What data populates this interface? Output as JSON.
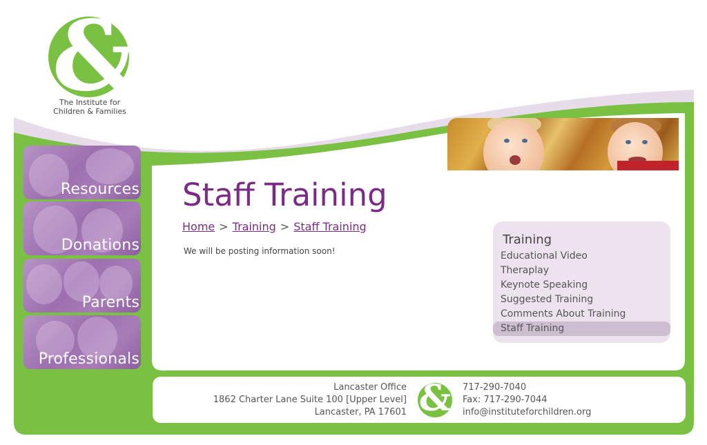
{
  "logo": {
    "line1": "The Institute for",
    "line2": "Children & Families"
  },
  "side_nav": {
    "items": [
      {
        "label": "Resources"
      },
      {
        "label": "Donations"
      },
      {
        "label": "Parents"
      },
      {
        "label": "Professionals"
      }
    ]
  },
  "main": {
    "title": "Staff Training",
    "breadcrumb": {
      "home": "Home",
      "sep1": ">",
      "training": "Training",
      "sep2": ">",
      "current": "Staff Training"
    },
    "body": "We will be posting information soon!"
  },
  "submenu": {
    "title": "Training",
    "items": [
      {
        "label": "Educational Video"
      },
      {
        "label": "Theraplay"
      },
      {
        "label": "Keynote Speaking"
      },
      {
        "label": "Suggested Training"
      },
      {
        "label": "Comments About Training"
      },
      {
        "label": "Staff Training"
      }
    ],
    "active_item": "Staff Training"
  },
  "footer": {
    "office_name": "Lancaster Office",
    "address_line1": "1862 Charter Lane Suite 100 [Upper Level]",
    "address_line2": "Lancaster, PA 17601",
    "phone": "717-290-7040",
    "fax": "Fax: 717-290-7044",
    "email": "info@instituteforchildren.org"
  },
  "colors": {
    "brand_green": "#7ac143",
    "brand_purple": "#7b2a85",
    "lavender": "#ece3ee",
    "nav_tile_purple": "#9d6faf"
  },
  "icons": {
    "logo_mark": "ampersand-logo-icon"
  }
}
